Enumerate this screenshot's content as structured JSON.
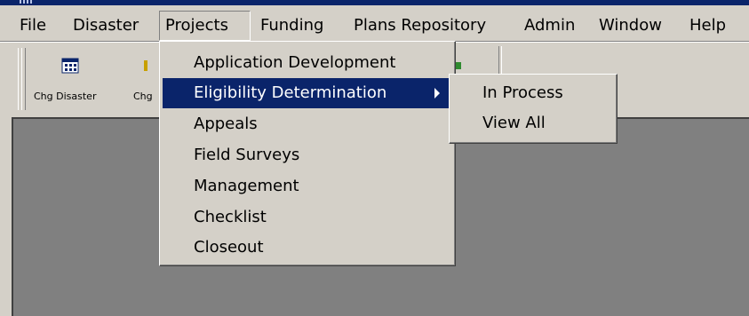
{
  "menubar": {
    "items": [
      {
        "label": "File"
      },
      {
        "label": "Disaster"
      },
      {
        "label": "Projects"
      },
      {
        "label": "Funding"
      },
      {
        "label": "Plans Repository"
      },
      {
        "label": "Admin"
      },
      {
        "label": "Window"
      },
      {
        "label": "Help"
      }
    ],
    "open_item": "Projects"
  },
  "toolbar": {
    "buttons": [
      {
        "label": "Chg Disaster",
        "icon": "calendar-icon"
      },
      {
        "label": "Chg",
        "icon": "toolbar-icon"
      }
    ]
  },
  "projects_menu": {
    "items": [
      {
        "label": "Application Development"
      },
      {
        "label": "Eligibility Determination",
        "has_submenu": true,
        "highlighted": true
      },
      {
        "label": "Appeals"
      },
      {
        "label": "Field Surveys"
      },
      {
        "label": "Management"
      },
      {
        "label": "Checklist"
      },
      {
        "label": "Closeout"
      }
    ]
  },
  "eligibility_submenu": {
    "items": [
      {
        "label": "In Process"
      },
      {
        "label": "View All"
      }
    ]
  },
  "colors": {
    "face": "#d4d0c8",
    "highlight": "#0a246a",
    "mdi_background": "#808080"
  }
}
